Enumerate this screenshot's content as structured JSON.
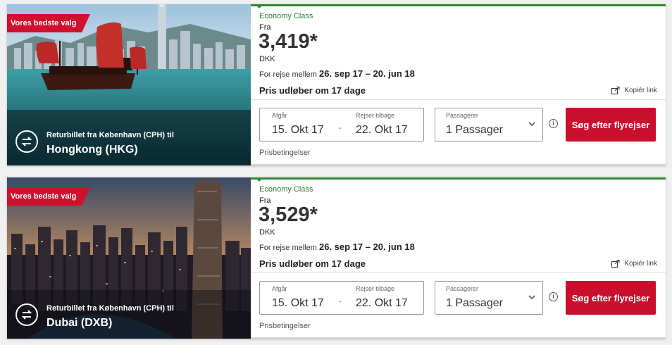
{
  "cards": [
    {
      "badge": "Vores bedste valg",
      "route_label": "Returbillet fra København (CPH) til",
      "destination": "Hongkong (HKG)",
      "cabin_class": "Economy Class",
      "from_label": "Fra",
      "price": "3,419*",
      "currency": "DKK",
      "travel_label": "For rejse mellem",
      "travel_dates": "26. sep 17 – 20. jun 18",
      "expires": "Pris udløber om 17 dage",
      "copy_link": "Kopiér link",
      "depart_label": "Afgår",
      "depart_value": "15. Okt 17",
      "return_label": "Rejser tilbage",
      "return_value": "22. Okt 17",
      "passengers_label": "Passagerer",
      "passengers_value": "1 Passager",
      "info_icon": "i",
      "search_button": "Søg efter flyrejser",
      "conditions_link": "Prisbetingelser"
    },
    {
      "badge": "Vores bedste valg",
      "route_label": "Returbillet fra København (CPH) til",
      "destination": "Dubai (DXB)",
      "cabin_class": "Economy Class",
      "from_label": "Fra",
      "price": "3,529*",
      "currency": "DKK",
      "travel_label": "For rejse mellem",
      "travel_dates": "26. sep 17 – 20. jun 18",
      "expires": "Pris udløber om 17 dage",
      "copy_link": "Kopiér link",
      "depart_label": "Afgår",
      "depart_value": "15. Okt 17",
      "return_label": "Rejser tilbage",
      "return_value": "22. Okt 17",
      "passengers_label": "Passagerer",
      "passengers_value": "1 Passager",
      "info_icon": "i",
      "search_button": "Søg efter flyrejser",
      "conditions_link": "Prisbetingelser"
    }
  ],
  "colors": {
    "brand_red": "#c8102e",
    "economy_green": "#2e8b2e"
  },
  "icons": [
    "swap-arrows-icon",
    "share-link-icon",
    "info-icon",
    "chevron-down-icon"
  ]
}
